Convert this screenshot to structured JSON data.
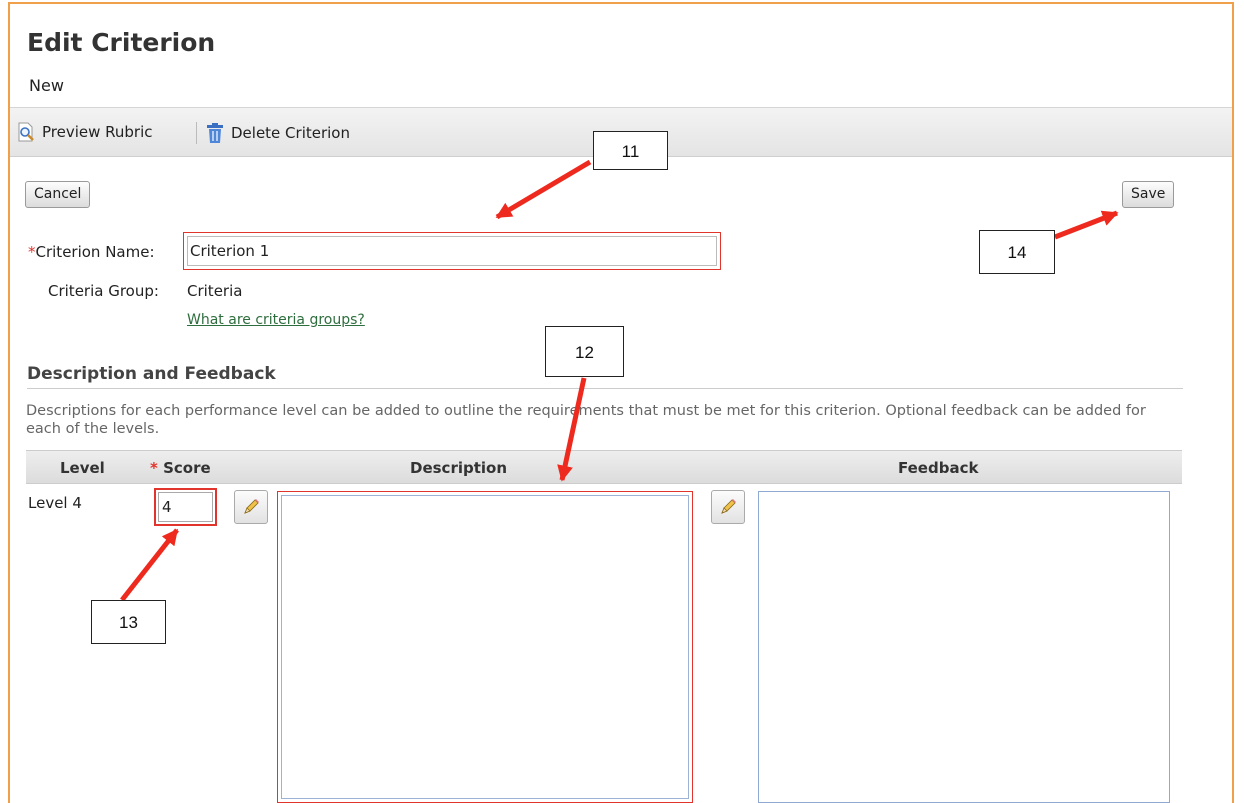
{
  "header": {
    "title": "Edit Criterion",
    "subtitle": "New"
  },
  "toolbar": {
    "preview_label": "Preview Rubric",
    "delete_label": "Delete Criterion"
  },
  "actions": {
    "cancel_label": "Cancel",
    "save_label": "Save"
  },
  "form": {
    "required_mark": "*",
    "criterion_name_label": "Criterion Name:",
    "criterion_name_value": "Criterion 1",
    "criteria_group_label": "Criteria Group:",
    "criteria_group_value": "Criteria",
    "criteria_group_help_link": "What are criteria groups?"
  },
  "section": {
    "title": "Description and Feedback",
    "description": "Descriptions for each performance level can be added to outline the requirements that must be met for this criterion. Optional feedback can be added for each of the levels."
  },
  "table": {
    "headers": {
      "level": "Level",
      "score_required": "*",
      "score": "Score",
      "description": "Description",
      "feedback": "Feedback"
    },
    "rows": [
      {
        "level": "Level 4",
        "score": "4",
        "description": "",
        "feedback": ""
      }
    ]
  },
  "callouts": [
    "11",
    "12",
    "13",
    "14"
  ],
  "colors": {
    "frame": "#f0a04b",
    "highlight": "#e0342c",
    "link": "#2e6e3e",
    "arrow": "#ee2a1f"
  }
}
